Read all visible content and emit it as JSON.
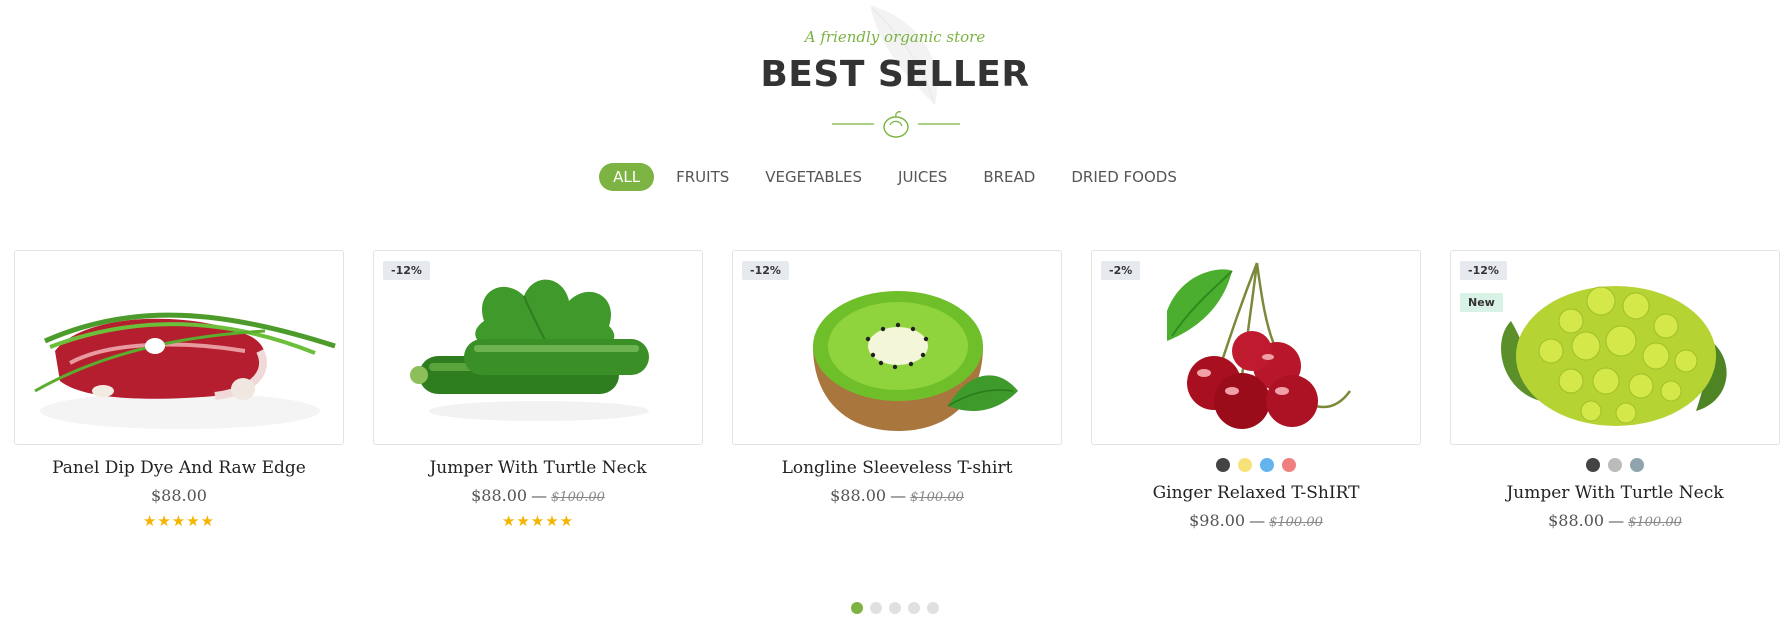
{
  "section": {
    "subtitle": "A friendly organic store",
    "title": "BEST SELLER"
  },
  "colors": {
    "accent": "#7cb342",
    "star": "#f5b400",
    "badge_sale_bg": "#e6eaee",
    "badge_new_bg": "#d8f2e6"
  },
  "tabs": [
    {
      "label": "ALL",
      "active": true
    },
    {
      "label": "FRUITS"
    },
    {
      "label": "VEGETABLES"
    },
    {
      "label": "JUICES"
    },
    {
      "label": "BREAD"
    },
    {
      "label": "DRIED FOODS"
    }
  ],
  "products": [
    {
      "name": "Panel Dip Dye And Raw Edge",
      "price": "$88.00",
      "old_price": "",
      "sale_badge": "",
      "new_badge": "",
      "rating": 5,
      "stars": "★★★★★",
      "image": "beef-steak-with-green-onion",
      "swatches": []
    },
    {
      "name": "Jumper With Turtle Neck",
      "price": "$88.00",
      "old_price": "$100.00",
      "sale_badge": "-12%",
      "new_badge": "",
      "rating": 5,
      "stars": "★★★★★",
      "image": "zucchini",
      "swatches": []
    },
    {
      "name": "Longline Sleeveless T-shirt",
      "price": "$88.00",
      "old_price": "$100.00",
      "sale_badge": "-12%",
      "new_badge": "",
      "rating": 0,
      "stars": "",
      "image": "kiwi-half",
      "swatches": []
    },
    {
      "name": "Ginger Relaxed T-ShIRT",
      "price": "$98.00",
      "old_price": "$100.00",
      "sale_badge": "-2%",
      "new_badge": "",
      "rating": 0,
      "stars": "",
      "image": "cherries",
      "swatches": [
        "#444444",
        "#f7e27a",
        "#63b3ed",
        "#f08080"
      ]
    },
    {
      "name": "Jumper With Turtle Neck",
      "price": "$88.00",
      "old_price": "$100.00",
      "sale_badge": "-12%",
      "new_badge": "New",
      "rating": 0,
      "stars": "",
      "image": "romanesco-broccoli",
      "swatches": [
        "#444444",
        "#bbbbbb",
        "#90a4ae"
      ]
    }
  ],
  "pagination": {
    "count": 5,
    "active": 0
  }
}
